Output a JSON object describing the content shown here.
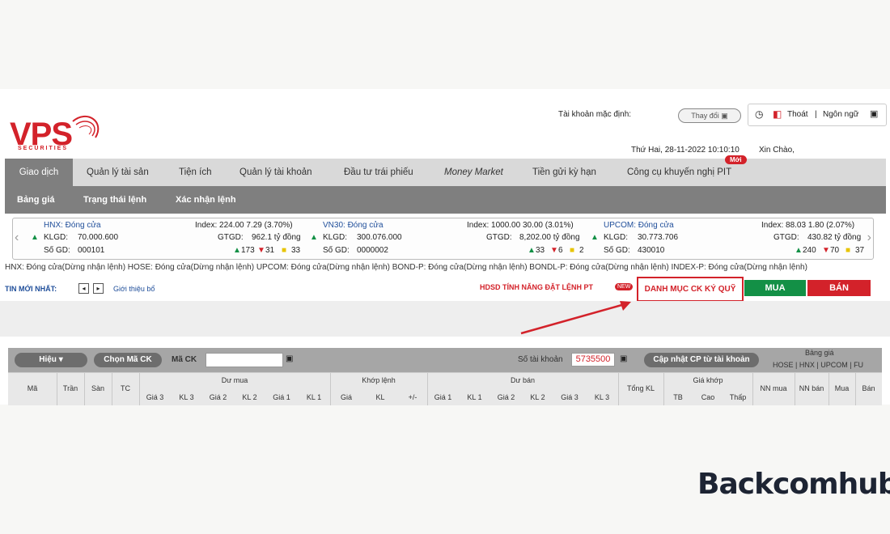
{
  "logo": {
    "text": "VPS",
    "sub": "SECURITIES"
  },
  "header": {
    "account_label": "Tài khoản mặc định:",
    "change_button": "Thay đổi",
    "logout": "Thoát",
    "language": "Ngôn ngữ",
    "datetime": "Thứ Hai, 28-11-2022 10:10:10",
    "greeting": "Xin Chào,"
  },
  "nav": {
    "items": [
      "Giao dịch",
      "Quản lý tài sản",
      "Tiện ích",
      "Quản lý tài khoản",
      "Đầu tư trái phiếu",
      "Money Market",
      "Tiền gửi kỳ hạn",
      "Công cụ khuyến nghị PIT"
    ],
    "new_badge": "Mới"
  },
  "subnav": {
    "items": [
      "Bảng giá",
      "Trạng thái lệnh",
      "Xác nhận lệnh"
    ]
  },
  "ticker": {
    "blocks": [
      {
        "name": "HNX: Đóng cửa",
        "index": "Index: 224.00 7.29 (3.70%)",
        "klgd_label": "KLGD:",
        "klgd": "70.000.600",
        "gtgd_label": "GTGD:",
        "gtgd": "962.1 tỷ đồng",
        "sogd_label": "Số GD:",
        "sogd": "000101",
        "up": "173",
        "down": "31",
        "flat": "33"
      },
      {
        "name": "VN30: Đóng cửa",
        "index": "Index: 1000.00 30.00 (3.01%)",
        "klgd_label": "KLGD:",
        "klgd": "300.076.000",
        "gtgd_label": "GTGD:",
        "gtgd": "8,202.00 tỷ đồng",
        "sogd_label": "Số GD:",
        "sogd": "0000002",
        "up": "33",
        "down": "6",
        "flat": "2"
      },
      {
        "name": "UPCOM: Đóng cửa",
        "index": "Index: 88.03 1.80 (2.07%)",
        "klgd_label": "KLGD:",
        "klgd": "30.773.706",
        "gtgd_label": "GTGD:",
        "gtgd": "430.82 tỷ đồng",
        "sogd_label": "Số GD:",
        "sogd": "430010",
        "up": "240",
        "down": "70",
        "flat": "37"
      }
    ]
  },
  "status_line": "HNX: Đóng cửa(Dừng nhận lệnh)   HOSE: Đóng cửa(Dừng nhận lệnh)   UPCOM: Đóng cửa(Dừng nhận lệnh)   BOND-P: Đóng cửa(Dừng nhận lệnh)   BONDL-P: Đóng cửa(Dừng nhận lệnh)   INDEX-P: Đóng cửa(Dừng nhận lệnh)",
  "news": {
    "label": "TIN MỚI NHẤT:",
    "link": "Giới thiệu bổ"
  },
  "actions": {
    "guide": "HDSD TÍNH NĂNG ĐẶT LỆNH PT",
    "new": "NEW",
    "watchlist": "DANH MỤC CK KÝ QUỸ",
    "buy": "MUA",
    "sell": "BÁN"
  },
  "filter": {
    "list_select": "Hiệu",
    "choose_code": "Chọn Mã CK",
    "code_label": "Mã CK",
    "account_label": "Số tài khoản",
    "account_value": "5735500",
    "update_button": "Cập nhật CP từ tài khoản",
    "board_title": "Bảng giá",
    "boards": [
      "HOSE",
      "HNX",
      "UPCOM",
      "FU"
    ]
  },
  "table": {
    "cols_left": [
      "Mã",
      "Trần",
      "Sàn",
      "TC"
    ],
    "group_buy": "Dư mua",
    "buy_sub": [
      "Giá 3",
      "KL 3",
      "Giá 2",
      "KL 2",
      "Giá 1",
      "KL 1"
    ],
    "group_match": "Khớp lệnh",
    "match_sub": [
      "Giá",
      "KL",
      "+/-"
    ],
    "group_sell": "Dư bán",
    "sell_sub": [
      "Giá 1",
      "KL 1",
      "Giá 2",
      "KL 2",
      "Giá 3",
      "KL 3"
    ],
    "total": "Tổng KL",
    "group_price": "Giá khớp",
    "price_sub": [
      "TB",
      "Cao",
      "Thấp"
    ],
    "cols_right": [
      "NN mua",
      "NN bán",
      "Mua",
      "Bán"
    ]
  },
  "watermark": "Backcomhub",
  "colors": {
    "brand": "#d3222a",
    "buy": "#139046",
    "sell": "#d3222a",
    "nav": "#7f7f7f"
  }
}
